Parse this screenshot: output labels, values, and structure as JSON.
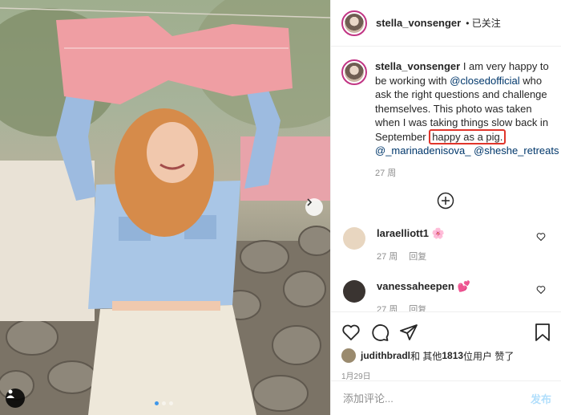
{
  "post": {
    "username": "stella_vonsenger",
    "follow_status": "• 已关注",
    "caption": {
      "user": "stella_vonsenger",
      "text_1": " I am very happy to be working with ",
      "mention_1": "@closedofficial",
      "text_2": " who ask the right questions and challenge themselves. This photo was taken when I was taking things slow back in September ",
      "highlight": "happy as a pig.",
      "mention_2": "@_marinadenisova_",
      "mention_3": "@sheshe_retreats",
      "time": "27 周"
    },
    "comments": [
      {
        "user": "laraelliott1",
        "emoji": "🌸",
        "time": "27 周",
        "reply": "回复",
        "avatar_color": "#e8d6c0"
      },
      {
        "user": "vanessaheepen",
        "emoji": "💕",
        "time": "27 周",
        "reply": "回复",
        "avatar_color": "#3a3431"
      }
    ],
    "likes": {
      "user": "judithbradl",
      "text": " 和 其他 ",
      "count": "1813",
      "suffix": " 位用户 赞了"
    },
    "date": "1月29日",
    "comment_input": {
      "placeholder": "添加评论...",
      "value": ""
    },
    "post_button": "发布"
  },
  "carousel": {
    "slides": 3,
    "active": 0
  },
  "colors": {
    "accent": "#3f97ea",
    "mention": "#00376b",
    "highlight_border": "#e0352b",
    "post_button": "#b2dffc"
  },
  "icons": [
    "chevron-right-icon",
    "user-tag-icon",
    "add-circle-icon",
    "heart-icon",
    "comment-icon",
    "share-icon",
    "bookmark-icon"
  ]
}
